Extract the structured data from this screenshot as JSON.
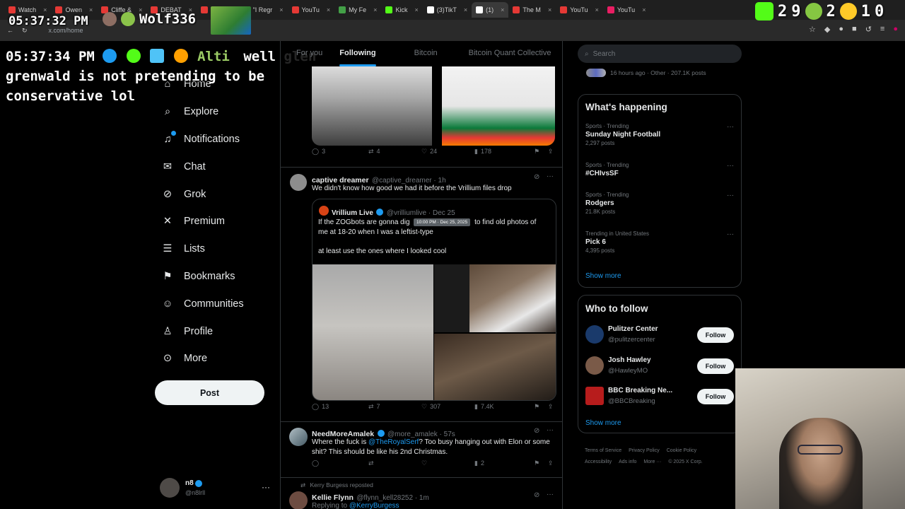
{
  "browser": {
    "tabs": [
      {
        "label": "Watch",
        "color": "#e53935"
      },
      {
        "label": "Owen",
        "color": "#e53935"
      },
      {
        "label": "Cliffe &",
        "color": "#e53935"
      },
      {
        "label": "DEBAT",
        "color": "#e53935"
      },
      {
        "label": "Wou",
        "color": "#e53935"
      },
      {
        "label": "\"I Regr",
        "color": "#e53935"
      },
      {
        "label": "YouTu",
        "color": "#e53935"
      },
      {
        "label": "My Fe",
        "color": "#43a047"
      },
      {
        "label": "Kick",
        "color": "#53fc18"
      },
      {
        "label": "(3)TikT",
        "color": "#ffffff"
      },
      {
        "label": "(1)",
        "color": "#ffffff"
      },
      {
        "label": "The M",
        "color": "#e53935"
      },
      {
        "label": "YouTu",
        "color": "#e53935"
      },
      {
        "label": "YouTu",
        "color": "#e91e63"
      }
    ],
    "url": "x.com/home"
  },
  "overlay": {
    "clock_top": "05:37:32 PM",
    "user_top": "Wolf336",
    "counters": [
      "2",
      "9",
      "2",
      "1",
      "0"
    ],
    "clock_chat": "05:37:34 PM",
    "chat_user": "Alti",
    "chat_message_1": "well glen",
    "chat_message_2": "grenwald is not pretending to be",
    "chat_message_3": "conservative lol"
  },
  "nav": {
    "items": [
      {
        "label": "Home",
        "icon": "home-icon"
      },
      {
        "label": "Explore",
        "icon": "search-icon"
      },
      {
        "label": "Notifications",
        "icon": "bell-icon"
      },
      {
        "label": "Chat",
        "icon": "mail-icon"
      },
      {
        "label": "Grok",
        "icon": "grok-icon"
      },
      {
        "label": "Premium",
        "icon": "x-logo-icon"
      },
      {
        "label": "Lists",
        "icon": "list-icon"
      },
      {
        "label": "Bookmarks",
        "icon": "bookmark-icon"
      },
      {
        "label": "Communities",
        "icon": "people-icon"
      },
      {
        "label": "Profile",
        "icon": "person-icon"
      },
      {
        "label": "More",
        "icon": "more-circle-icon"
      }
    ],
    "post_label": "Post",
    "account_name": "n8",
    "account_handle": "@n8lrll"
  },
  "timeline": {
    "tabs": [
      "For you",
      "Following",
      "Bitcoin",
      "Bitcoin Quant Collective"
    ],
    "first_post_actions": {
      "replies": "3",
      "reposts": "4",
      "likes": "24",
      "views": "178"
    },
    "post1": {
      "name": "captive dreamer",
      "handle": "@captive_dreamer · 1h",
      "text": "We didn't know how good we had it before the Vrillium files drop",
      "quote_name": "Vrillium Live",
      "quote_handle": "@vrilliumlive · Dec 25",
      "tooltip": "10:00 PM · Dec 25, 2025",
      "quote_text_1": "If the ZOGbots are gonna dig",
      "quote_text_1b": "to find old photos of",
      "quote_text_2": "me at 18-20 when I was a leftist-type",
      "quote_text_3": "at least use the ones where I looked cool",
      "actions": {
        "replies": "13",
        "reposts": "7",
        "likes": "307",
        "views": "7.4K"
      }
    },
    "post2": {
      "name": "NeedMoreAmalek",
      "handle": "@more_amalek · 57s",
      "text_a": "Where the fuck is ",
      "mention": "@TheRoyalSerf",
      "text_b": "? Too busy hanging out with Elon or some",
      "text_c": "shit? This should be like his 2nd Christmas.",
      "views": "2"
    },
    "post3": {
      "repost_label": "Kerry Burgess reposted",
      "name": "Kellie Flynn",
      "handle": "@flynn_kell28252 · 1m",
      "replying": "Replying to ",
      "replying_to": "@KerryBurgess"
    }
  },
  "sidebar": {
    "search_placeholder": "Search",
    "top_meta": "16 hours ago · Other · 207.1K posts",
    "whats_happening_title": "What's happening",
    "trends": [
      {
        "category": "Sports · Trending",
        "name": "Sunday Night Football",
        "count": "2,297 posts"
      },
      {
        "category": "Sports · Trending",
        "name": "#CHIvsSF",
        "count": ""
      },
      {
        "category": "Sports · Trending",
        "name": "Rodgers",
        "count": "21.8K posts"
      },
      {
        "category": "Trending in United States",
        "name": "Pick 6",
        "count": "4,395 posts"
      }
    ],
    "show_more": "Show more",
    "who_to_follow_title": "Who to follow",
    "follow": [
      {
        "name": "Pulitzer Center",
        "handle": "@pulitzercenter",
        "button": "Follow"
      },
      {
        "name": "Josh Hawley",
        "handle": "@HawleyMO",
        "button": "Follow"
      },
      {
        "name": "BBC Breaking Ne...",
        "handle": "@BBCBreaking",
        "button": "Follow"
      }
    ],
    "show_more_2": "Show more",
    "footer_1": [
      "Terms of Service",
      "Privacy Policy",
      "Cookie Policy"
    ],
    "footer_2": [
      "Accessibility",
      "Ads info",
      "More ···",
      "© 2025 X Corp."
    ]
  }
}
